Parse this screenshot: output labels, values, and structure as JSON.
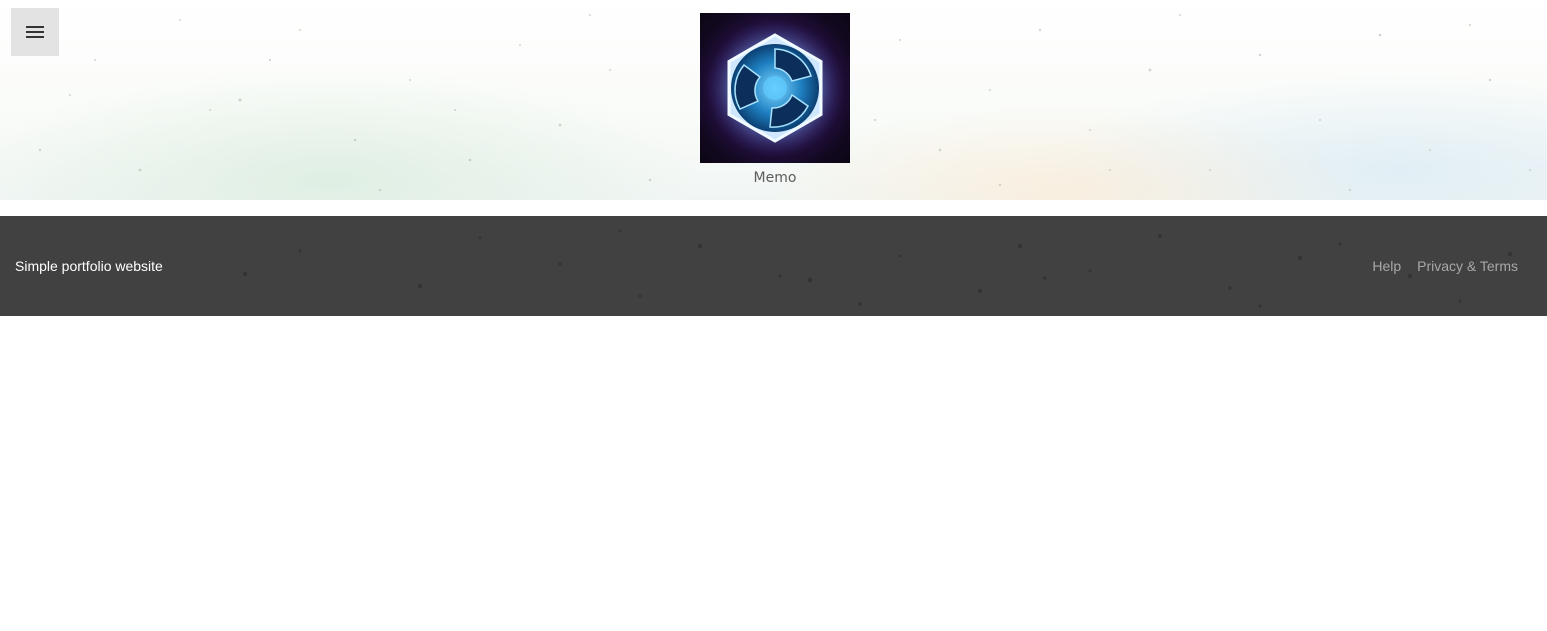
{
  "header": {
    "menu_icon": "hamburger-menu-icon"
  },
  "project": {
    "logo_icon": "heroes-of-the-storm-logo",
    "caption": "Memo"
  },
  "footer": {
    "title": "Simple portfolio website",
    "links": [
      {
        "label": "Help"
      },
      {
        "label": "Privacy & Terms"
      }
    ]
  },
  "colors": {
    "footer_bg": "#414141",
    "menu_button_bg": "#e3e3e3",
    "link": "#a8a8a8"
  }
}
